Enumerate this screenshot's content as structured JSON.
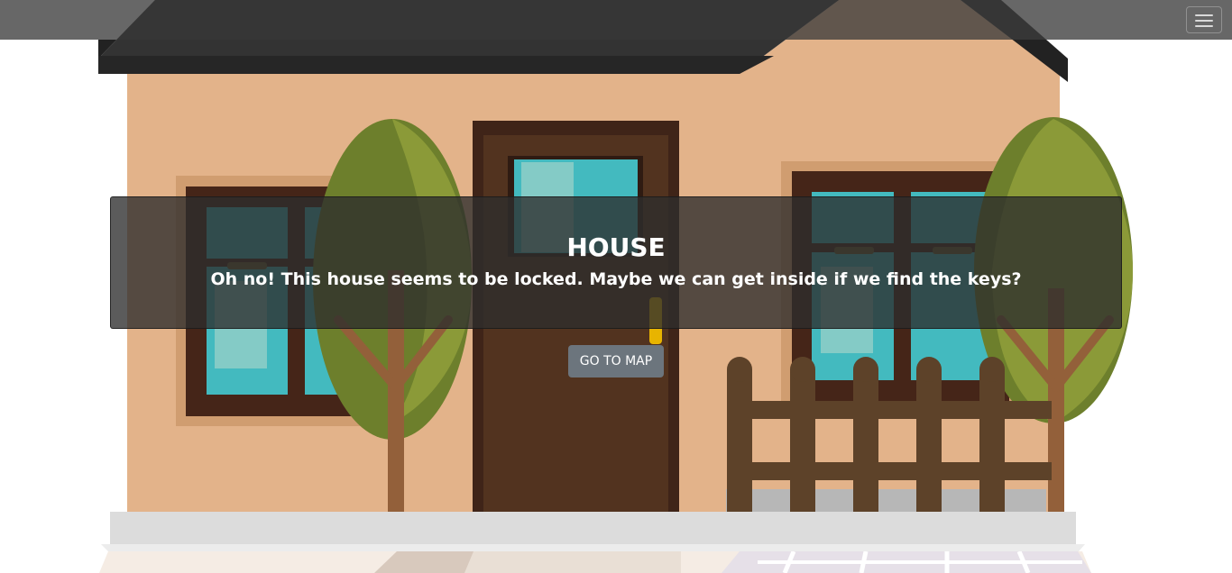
{
  "scene": {
    "name": "house-exterior",
    "colors": {
      "wall": "#e3b38a",
      "roof": "#222222",
      "door": "#52331f",
      "door_frame": "#3f2418",
      "window_glass": "#43babf",
      "tree": "#8b9a38",
      "trunk": "#93603a",
      "fence": "#5d4229"
    }
  },
  "navbar": {
    "toggle_icon": "hamburger-icon"
  },
  "dialog": {
    "title": "HOUSE",
    "message": "Oh no! This house seems to be locked. Maybe we can get inside if we find the keys?",
    "button_label": "GO TO MAP"
  }
}
